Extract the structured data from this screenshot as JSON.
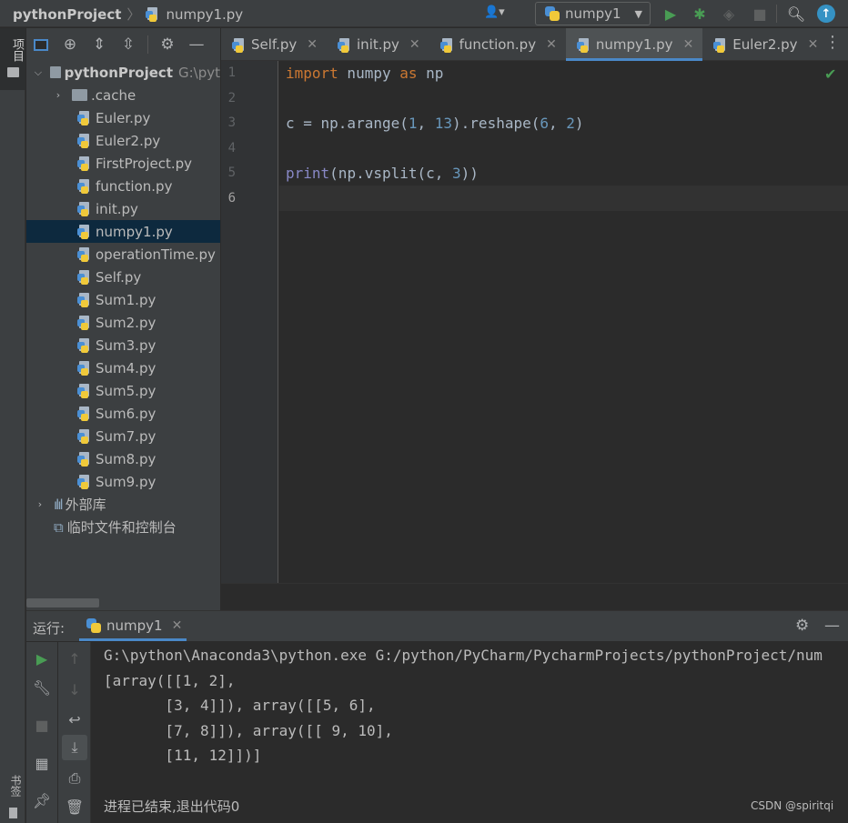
{
  "titlebar": {
    "project": "pythonProject",
    "file": "numpy1.py",
    "run_config": "numpy1"
  },
  "stripe": {
    "project_label": "项目",
    "bookmarks_label": "书签"
  },
  "project_tree": {
    "root": "pythonProject",
    "root_path": "G:\\pyt",
    "items": [
      {
        "label": ".cache",
        "type": "folder"
      },
      {
        "label": "Euler.py",
        "type": "py"
      },
      {
        "label": "Euler2.py",
        "type": "py"
      },
      {
        "label": "FirstProject.py",
        "type": "py"
      },
      {
        "label": "function.py",
        "type": "py"
      },
      {
        "label": "init.py",
        "type": "py"
      },
      {
        "label": "numpy1.py",
        "type": "py",
        "selected": true
      },
      {
        "label": "operationTime.py",
        "type": "py"
      },
      {
        "label": "Self.py",
        "type": "py"
      },
      {
        "label": "Sum1.py",
        "type": "py"
      },
      {
        "label": "Sum2.py",
        "type": "py"
      },
      {
        "label": "Sum3.py",
        "type": "py"
      },
      {
        "label": "Sum4.py",
        "type": "py"
      },
      {
        "label": "Sum5.py",
        "type": "py"
      },
      {
        "label": "Sum6.py",
        "type": "py"
      },
      {
        "label": "Sum7.py",
        "type": "py"
      },
      {
        "label": "Sum8.py",
        "type": "py"
      },
      {
        "label": "Sum9.py",
        "type": "py"
      }
    ],
    "external_libs": "外部库",
    "scratches": "临时文件和控制台"
  },
  "editor_tabs": [
    {
      "label": "Self.py"
    },
    {
      "label": "init.py"
    },
    {
      "label": "function.py"
    },
    {
      "label": "numpy1.py",
      "active": true
    },
    {
      "label": "Euler2.py"
    }
  ],
  "editor": {
    "line_numbers": [
      "1",
      "2",
      "3",
      "4",
      "5",
      "6"
    ],
    "code": {
      "l1_kw1": "import",
      "l1_mod": " numpy ",
      "l1_kw2": "as",
      "l1_alias": " np",
      "l3_a": "c = np.arange(",
      "l3_n1": "1",
      "l3_b": ", ",
      "l3_n2": "13",
      "l3_c": ").reshape(",
      "l3_n3": "6",
      "l3_d": ", ",
      "l3_n4": "2",
      "l3_e": ")",
      "l5_fn": "print",
      "l5_a": "(np.vsplit(c, ",
      "l5_n": "3",
      "l5_b": "))"
    }
  },
  "run_panel": {
    "label": "运行:",
    "tab": "numpy1",
    "output": [
      "G:\\python\\Anaconda3\\python.exe G:/python/PyCharm/PycharmProjects/pythonProject/num",
      "[array([[1, 2],",
      "       [3, 4]]), array([[5, 6],",
      "       [7, 8]]), array([[ 9, 10],",
      "       [11, 12]])]",
      "",
      "进程已结束,退出代码0"
    ]
  },
  "watermark": "CSDN @spiritqi"
}
